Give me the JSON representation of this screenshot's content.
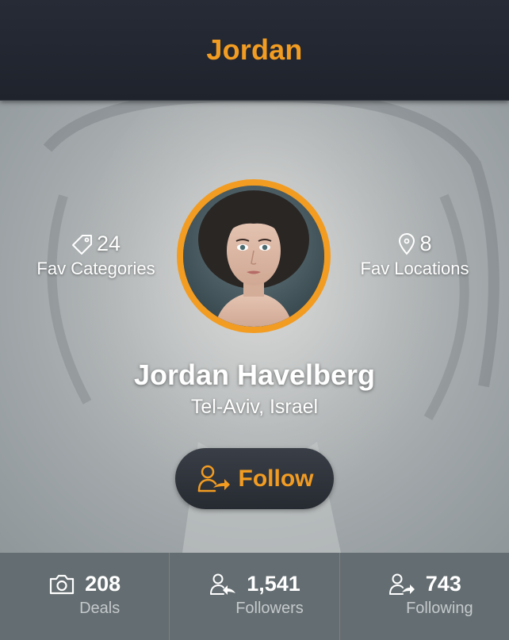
{
  "header": {
    "title": "Jordan"
  },
  "profile": {
    "name": "Jordan Havelberg",
    "location": "Tel-Aviv, Israel"
  },
  "fav_categories": {
    "icon": "tag-icon",
    "count": "24",
    "label": "Fav Categories"
  },
  "fav_locations": {
    "icon": "map-pin-icon",
    "count": "8",
    "label": "Fav Locations"
  },
  "follow_button": {
    "icon": "user-follow-icon",
    "label": "Follow"
  },
  "stats": [
    {
      "icon": "camera-icon",
      "value": "208",
      "label": "Deals"
    },
    {
      "icon": "followers-icon",
      "value": "1,541",
      "label": "Followers"
    },
    {
      "icon": "following-icon",
      "value": "743",
      "label": "Following"
    }
  ],
  "colors": {
    "accent": "#f29c22",
    "header_bg": "#232832",
    "button_bg": "#2e333b",
    "bottom_bar_bg": "#60686d"
  }
}
